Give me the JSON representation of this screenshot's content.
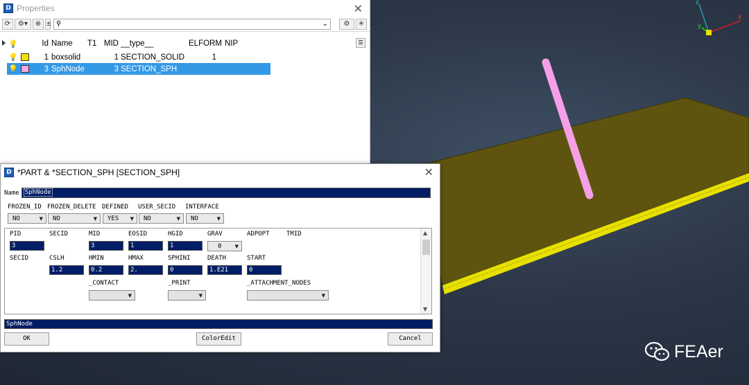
{
  "props_window": {
    "title": "Properties",
    "search_icon": "search-icon",
    "columns": [
      "Id",
      "Name",
      "T1",
      "MID",
      "__type__",
      "ELFORM",
      "NIP"
    ],
    "rows": [
      {
        "id": "1",
        "name": "boxsolid",
        "t1": "",
        "mid": "1",
        "type": "SECTION_SOLID",
        "elform": "1",
        "nip": "",
        "color": "#f2e200",
        "selected": false
      },
      {
        "id": "3",
        "name": "SphNode",
        "t1": "",
        "mid": "3",
        "type": "SECTION_SPH",
        "elform": "",
        "nip": "",
        "color": "#f7a6e6",
        "selected": true
      }
    ]
  },
  "dialog": {
    "title": "*PART & *SECTION_SPH [SECTION_SPH]",
    "name_label": "Name",
    "name_value": "SphNode",
    "flags": [
      {
        "label": "FROZEN_ID",
        "value": "NO"
      },
      {
        "label": "FROZEN_DELETE",
        "value": "NO"
      },
      {
        "label": "DEFINED",
        "value": "YES"
      },
      {
        "label": "USER_SECID",
        "value": "NO"
      },
      {
        "label": "INTERFACE",
        "value": "NO"
      }
    ],
    "row1_labels": [
      "PID",
      "SECID",
      "MID",
      "EOSID",
      "HGID",
      "GRAV",
      "ADPOPT",
      "TMID"
    ],
    "row1_values": {
      "pid": "3",
      "mid": "3",
      "eosid": "1",
      "hgid": "1",
      "grav": "0"
    },
    "row2_labels": [
      "SECID",
      "CSLH",
      "HMIN",
      "HMAX",
      "SPHINI",
      "DEATH",
      "START"
    ],
    "row2_values": {
      "cslh": "1.2",
      "hmin": "0.2",
      "hmax": "2.",
      "sphini": "0",
      "death": "1.E21",
      "start": "0"
    },
    "row3_labels": [
      "_CONTACT",
      "_PRINT",
      "_ATTACHMENT_NODES"
    ],
    "status_text": "SphNode",
    "buttons": {
      "ok": "OK",
      "color_edit": "ColorEdit",
      "cancel": "Cancel"
    }
  },
  "viewport": {
    "plate_color": "#5e5410",
    "edge_color": "#e8e000",
    "rod_color": "#f5a0e6",
    "axis_labels": {
      "x": "x",
      "y": "y",
      "z": "z"
    }
  },
  "watermark": {
    "text": "FEAer",
    "icon": "wechat-icon"
  }
}
